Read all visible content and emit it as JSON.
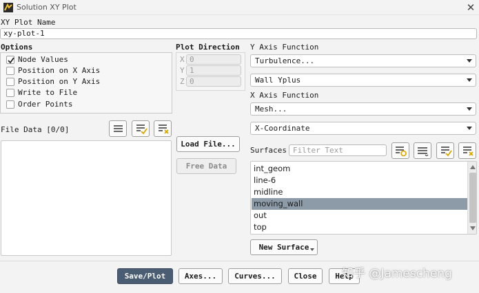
{
  "window": {
    "title": "Solution XY Plot"
  },
  "name_section": {
    "label": "XY Plot Name",
    "value": "xy-plot-1"
  },
  "options": {
    "label": "Options",
    "items": [
      {
        "label": "Node Values",
        "checked": true
      },
      {
        "label": "Position on X Axis",
        "checked": false
      },
      {
        "label": "Position on Y Axis",
        "checked": false
      },
      {
        "label": "Write to File",
        "checked": false
      },
      {
        "label": "Order Points",
        "checked": false
      }
    ]
  },
  "plot_direction": {
    "label": "Plot Direction",
    "x": {
      "label": "X",
      "value": "0"
    },
    "y": {
      "label": "Y",
      "value": "1"
    },
    "z": {
      "label": "Z",
      "value": "0"
    }
  },
  "file_data": {
    "label": "File Data [0/0]"
  },
  "buttons": {
    "load_file": "Load File...",
    "free_data": "Free Data",
    "new_surface": "New Surface",
    "save_plot": "Save/Plot",
    "axes": "Axes...",
    "curves": "Curves...",
    "close": "Close",
    "help": "Help"
  },
  "y_axis_function": {
    "label": "Y Axis Function",
    "category": "Turbulence...",
    "quantity": "Wall Yplus"
  },
  "x_axis_function": {
    "label": "X Axis Function",
    "category": "Mesh...",
    "quantity": "X-Coordinate"
  },
  "surfaces": {
    "label": "Surfaces",
    "filter_placeholder": "Filter Text",
    "items": [
      {
        "label": "int_geom",
        "selected": false
      },
      {
        "label": "line-6",
        "selected": false
      },
      {
        "label": "midline",
        "selected": false
      },
      {
        "label": "moving_wall",
        "selected": true
      },
      {
        "label": "out",
        "selected": false
      },
      {
        "label": "top",
        "selected": false
      }
    ]
  },
  "watermark": "知乎 @Jamescheng",
  "colors": {
    "selection": "#8d9ba9",
    "primary_button": "#4a5d72"
  },
  "icons": [
    "app-icon",
    "close-icon",
    "checkmark-icon",
    "list-icon",
    "list-check-icon",
    "list-clear-icon",
    "list-filter-icon",
    "scroll-up-icon",
    "scroll-down-icon",
    "dropdown-caret-icon"
  ]
}
